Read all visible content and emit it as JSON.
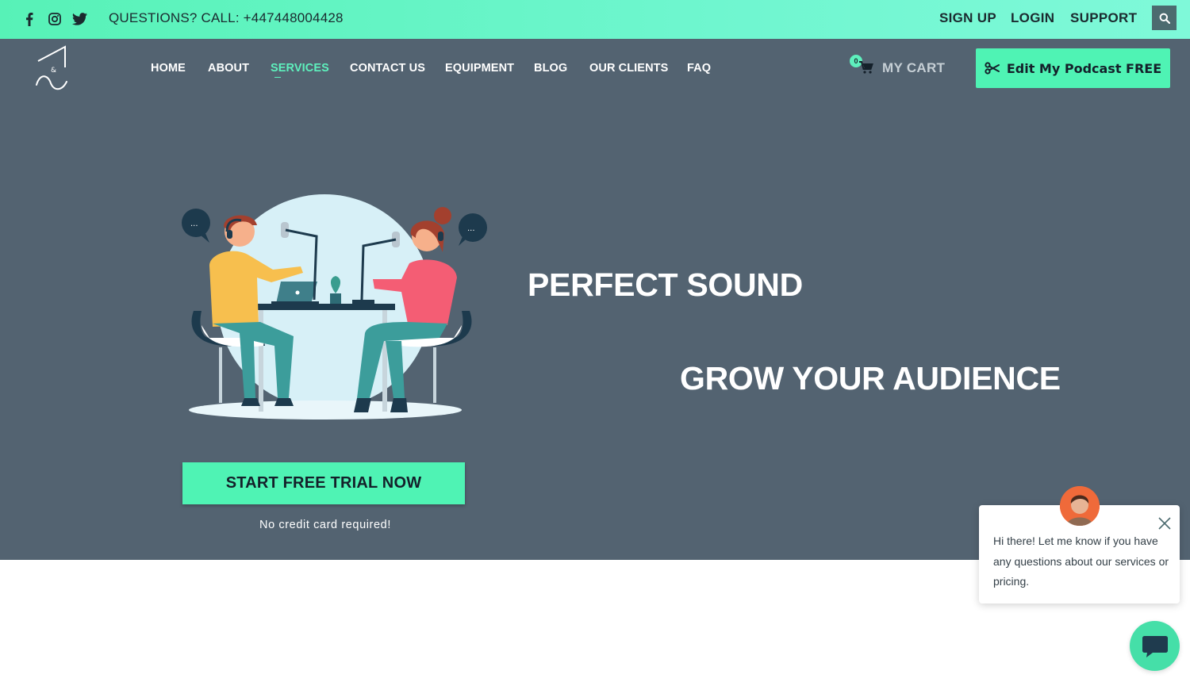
{
  "topbar": {
    "social": [
      {
        "icon": "facebook-icon"
      },
      {
        "icon": "instagram-icon"
      },
      {
        "icon": "twitter-icon"
      }
    ],
    "phone_text": "QUESTIONS? CALL: +447448004428",
    "links": {
      "signup": "SIGN UP",
      "login": "LOGIN",
      "support": "SUPPORT"
    },
    "search_icon": "search-icon"
  },
  "nav": {
    "items": [
      {
        "label": "HOME"
      },
      {
        "label": "ABOUT"
      },
      {
        "label": "SERVICES",
        "active": true
      },
      {
        "label": "CONTACT US"
      },
      {
        "label": "EQUIPMENT"
      },
      {
        "label": "BLOG"
      },
      {
        "label": "OUR CLIENTS"
      },
      {
        "label": "FAQ"
      }
    ],
    "cart": {
      "count": "0",
      "label": "MY CART"
    },
    "cta": {
      "icon": "scissors-icon",
      "label": "Edit My Podcast FREE"
    }
  },
  "hero": {
    "headline_1": "PERFECT SOUND",
    "headline_2": "GROW YOUR AUDIENCE",
    "start_button": "START FREE TRIAL NOW",
    "subtext": "No credit card required!"
  },
  "chat": {
    "message": "Hi there! Let me know if you have any questions about our services or pricing.",
    "launcher_icon": "chat-icon"
  },
  "colors": {
    "accent": "#4ff3b4",
    "hero_bg": "#536371",
    "topbar": "#6ff6cf"
  }
}
